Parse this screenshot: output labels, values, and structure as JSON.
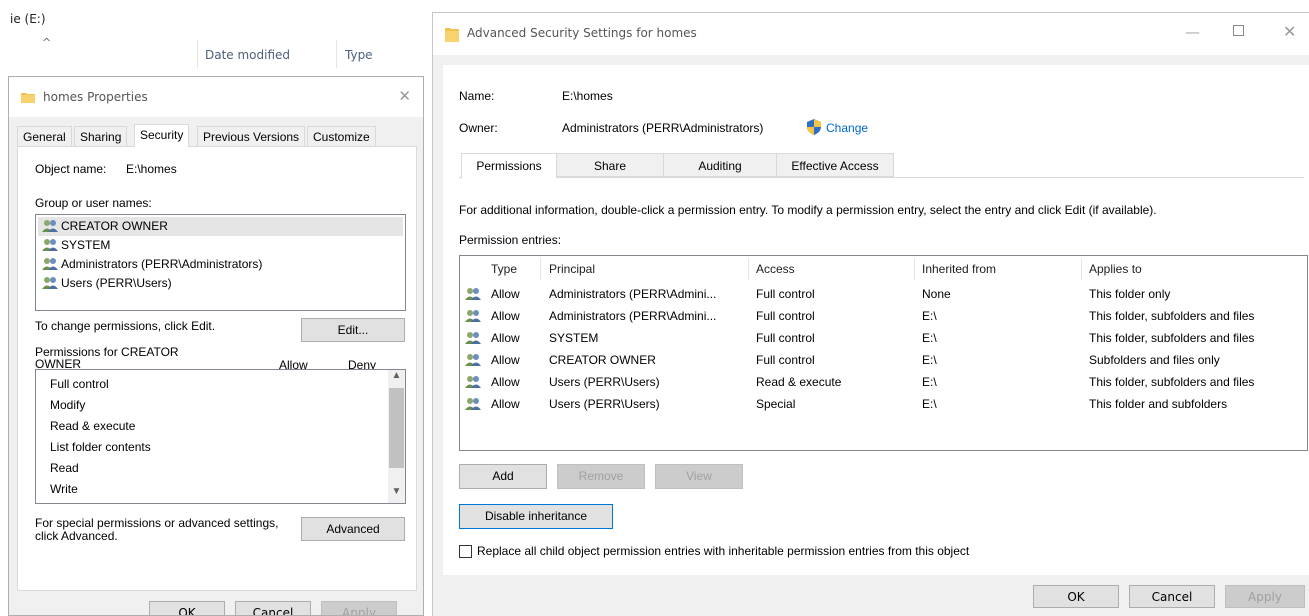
{
  "explorer": {
    "title": "ie (E:)",
    "columns": {
      "date_modified": "Date modified",
      "type": "Type"
    }
  },
  "props": {
    "title": "homes Properties",
    "tabs": [
      "General",
      "Sharing",
      "Security",
      "Previous Versions",
      "Customize"
    ],
    "active_tab": "Security",
    "object_name_label": "Object name:",
    "object_name_value": "E:\\homes",
    "group_label": "Group or user names:",
    "users": [
      "CREATOR OWNER",
      "SYSTEM",
      "Administrators (PERR\\Administrators)",
      "Users (PERR\\Users)"
    ],
    "change_perm_text": "To change permissions, click Edit.",
    "edit_button": "Edit...",
    "perms_for_line1": "Permissions for CREATOR",
    "perms_for_line2": "OWNER",
    "allow_header": "Allow",
    "deny_header": "Deny",
    "permissions": [
      "Full control",
      "Modify",
      "Read & execute",
      "List folder contents",
      "Read",
      "Write"
    ],
    "special_line1": "For special permissions or advanced settings,",
    "special_line2": "click Advanced.",
    "advanced_button": "Advanced",
    "ok_button": "OK",
    "cancel_button": "Cancel",
    "apply_button": "Apply"
  },
  "adv": {
    "title": "Advanced Security Settings for homes",
    "name_label": "Name:",
    "name_value": "E:\\homes",
    "owner_label": "Owner:",
    "owner_value": "Administrators (PERR\\Administrators)",
    "change_link": "Change",
    "tabs": [
      "Permissions",
      "Share",
      "Auditing",
      "Effective Access"
    ],
    "info_text": "For additional information, double-click a permission entry. To modify a permission entry, select the entry and click Edit (if available).",
    "entries_label": "Permission entries:",
    "columns": {
      "type": "Type",
      "principal": "Principal",
      "access": "Access",
      "inherited": "Inherited from",
      "applies": "Applies to"
    },
    "entries": [
      {
        "type": "Allow",
        "principal": "Administrators (PERR\\Admini...",
        "access": "Full control",
        "inherited": "None",
        "applies": "This folder only"
      },
      {
        "type": "Allow",
        "principal": "Administrators (PERR\\Admini...",
        "access": "Full control",
        "inherited": "E:\\",
        "applies": "This folder, subfolders and files"
      },
      {
        "type": "Allow",
        "principal": "SYSTEM",
        "access": "Full control",
        "inherited": "E:\\",
        "applies": "This folder, subfolders and files"
      },
      {
        "type": "Allow",
        "principal": "CREATOR OWNER",
        "access": "Full control",
        "inherited": "E:\\",
        "applies": "Subfolders and files only"
      },
      {
        "type": "Allow",
        "principal": "Users (PERR\\Users)",
        "access": "Read & execute",
        "inherited": "E:\\",
        "applies": "This folder, subfolders and files"
      },
      {
        "type": "Allow",
        "principal": "Users (PERR\\Users)",
        "access": "Special",
        "inherited": "E:\\",
        "applies": "This folder and subfolders"
      }
    ],
    "add_button": "Add",
    "remove_button": "Remove",
    "view_button": "View",
    "disable_inheritance_button": "Disable inheritance",
    "replace_checkbox_label": "Replace all child object permission entries with inheritable permission entries from this object",
    "ok_button": "OK",
    "cancel_button": "Cancel",
    "apply_button": "Apply"
  },
  "colors": {
    "accent": "#0078d7",
    "link": "#0066cc",
    "folder": "#f2c14e"
  }
}
